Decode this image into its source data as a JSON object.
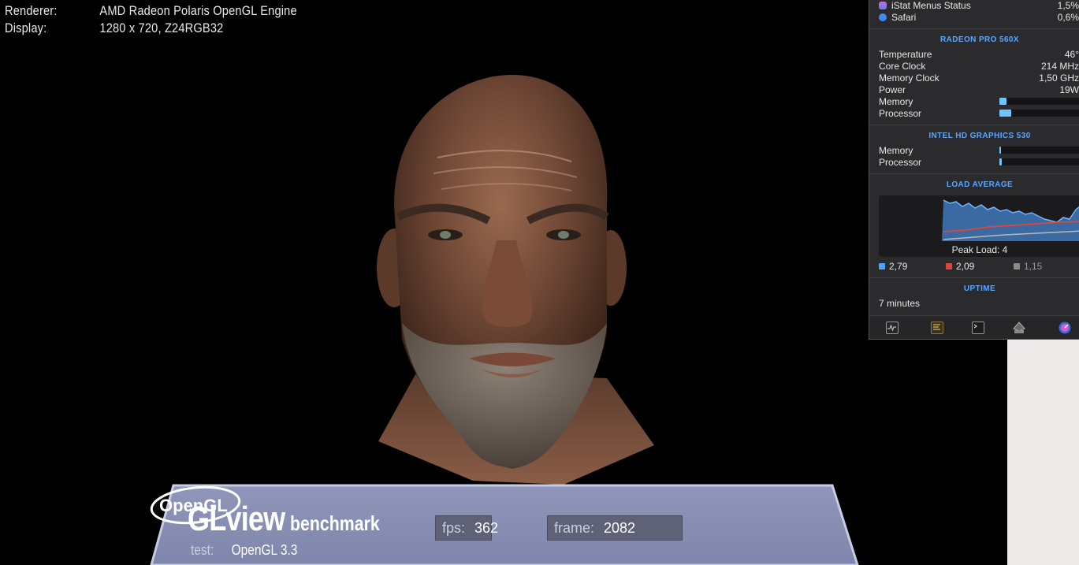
{
  "glview": {
    "renderer_label": "Renderer:",
    "renderer_value": "AMD Radeon Polaris OpenGL Engine",
    "display_label": "Display:",
    "display_value": "1280 x 720, Z24RGB32",
    "title_main": "GLview",
    "title_sub": "benchmark",
    "fps_label": "fps:",
    "fps_value": "362",
    "frame_label": "frame:",
    "frame_value": "2082",
    "test_label": "test:",
    "test_value": "OpenGL 3.3",
    "logo_text": "OpenGL",
    "panel_color": "#8a90b4"
  },
  "istat": {
    "processes": [
      {
        "name": "iStat Menus Status",
        "value": "1,5%",
        "icon": "istat-app-icon"
      },
      {
        "name": "Safari",
        "value": "0,6%",
        "icon": "safari-app-icon"
      }
    ],
    "gpu1": {
      "title": "RADEON PRO 560X",
      "rows": [
        {
          "label": "Temperature",
          "value": "46°"
        },
        {
          "label": "Core Clock",
          "value": "214 MHz"
        },
        {
          "label": "Memory Clock",
          "value": "1,50 GHz"
        },
        {
          "label": "Power",
          "value": "19W"
        }
      ],
      "memory_label": "Memory",
      "memory_level": 0.08,
      "processor_label": "Processor",
      "processor_level": 0.14
    },
    "gpu2": {
      "title": "INTEL HD GRAPHICS 530",
      "memory_label": "Memory",
      "memory_level": 0.02,
      "processor_label": "Processor",
      "processor_level": 0.03
    },
    "load": {
      "title": "LOAD AVERAGE",
      "peak": "Peak Load: 4",
      "avg1": "2,79",
      "avg5": "2,09",
      "avg15": "1,15",
      "color1": "#4ea3ff",
      "color5": "#e0463c",
      "color15": "#8a8a8a"
    },
    "uptime": {
      "title": "UPTIME",
      "value": "7 minutes"
    },
    "toolbar_icons": [
      "activity-monitor-icon",
      "console-icon",
      "terminal-icon",
      "disk-utility-icon",
      "istat-settings-icon"
    ],
    "accent": "#5aa6ff"
  }
}
